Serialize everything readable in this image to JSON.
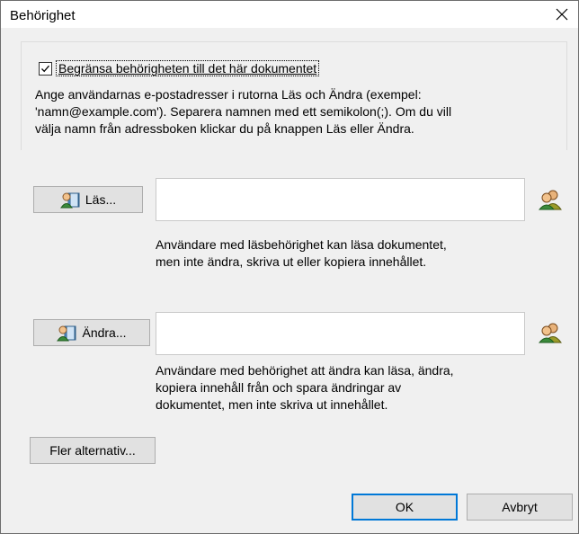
{
  "window": {
    "title": "Behörighet",
    "close_icon": "close-icon"
  },
  "restrict": {
    "checked": true,
    "label": "Begränsa behörigheten till det här dokumentet"
  },
  "instructions": "Ange användarnas e-postadresser i rutorna Läs och Ändra (exempel:\n'namn@example.com'). Separera namnen med ett semikolon(;). Om du vill\nvälja namn från adressboken klickar du på knappen Läs eller Ändra.",
  "read": {
    "button_label": "Läs...",
    "button_icon": "user-book-icon",
    "field_value": "",
    "addressbook_icon": "users-icon",
    "help": "Användare med läsbehörighet kan läsa dokumentet,\nmen inte ändra, skriva ut eller kopiera innehållet."
  },
  "change": {
    "button_label": "Ändra...",
    "button_icon": "user-book-icon",
    "field_value": "",
    "addressbook_icon": "users-icon",
    "help": "Användare med behörighet att ändra kan läsa, ändra,\nkopiera innehåll från och spara ändringar av\ndokumentet, men inte skriva ut innehållet."
  },
  "footer": {
    "more_options_label": "Fler alternativ...",
    "ok_label": "OK",
    "cancel_label": "Avbryt"
  }
}
